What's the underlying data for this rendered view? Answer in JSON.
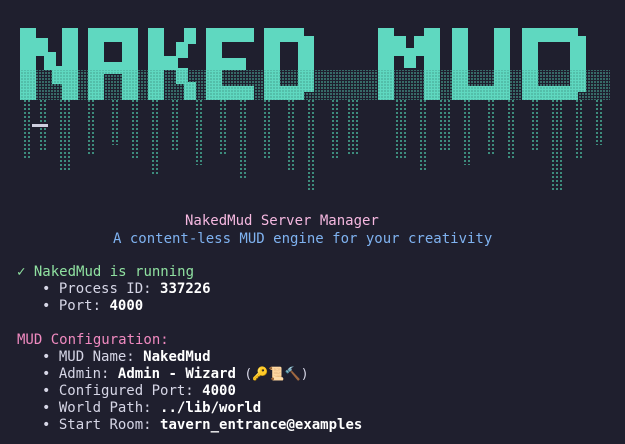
{
  "banner": {
    "text": "NAKED MUD",
    "color": "#5fd8c0",
    "drip_color": "#4aa896"
  },
  "header": {
    "title": "NakedMud Server Manager",
    "subtitle": "A content-less MUD engine for your creativity"
  },
  "status": {
    "icon": "check-icon",
    "check": "✓",
    "text": "NakedMud is running",
    "items": [
      {
        "label": "Process ID:",
        "value": "337226"
      },
      {
        "label": "Port:",
        "value": "4000"
      }
    ]
  },
  "config": {
    "heading": "MUD Configuration:",
    "items": [
      {
        "label": "MUD Name:",
        "value": "NakedMud",
        "extra": ""
      },
      {
        "label": "Admin:",
        "value": "Admin - Wizard",
        "extra": "(🔑📜🔨)"
      },
      {
        "label": "Configured Port:",
        "value": "4000",
        "extra": ""
      },
      {
        "label": "World Path:",
        "value": "../lib/world",
        "extra": ""
      },
      {
        "label": "Start Room:",
        "value": "tavern_entrance@examples",
        "extra": ""
      }
    ]
  },
  "bullet_char": "•"
}
